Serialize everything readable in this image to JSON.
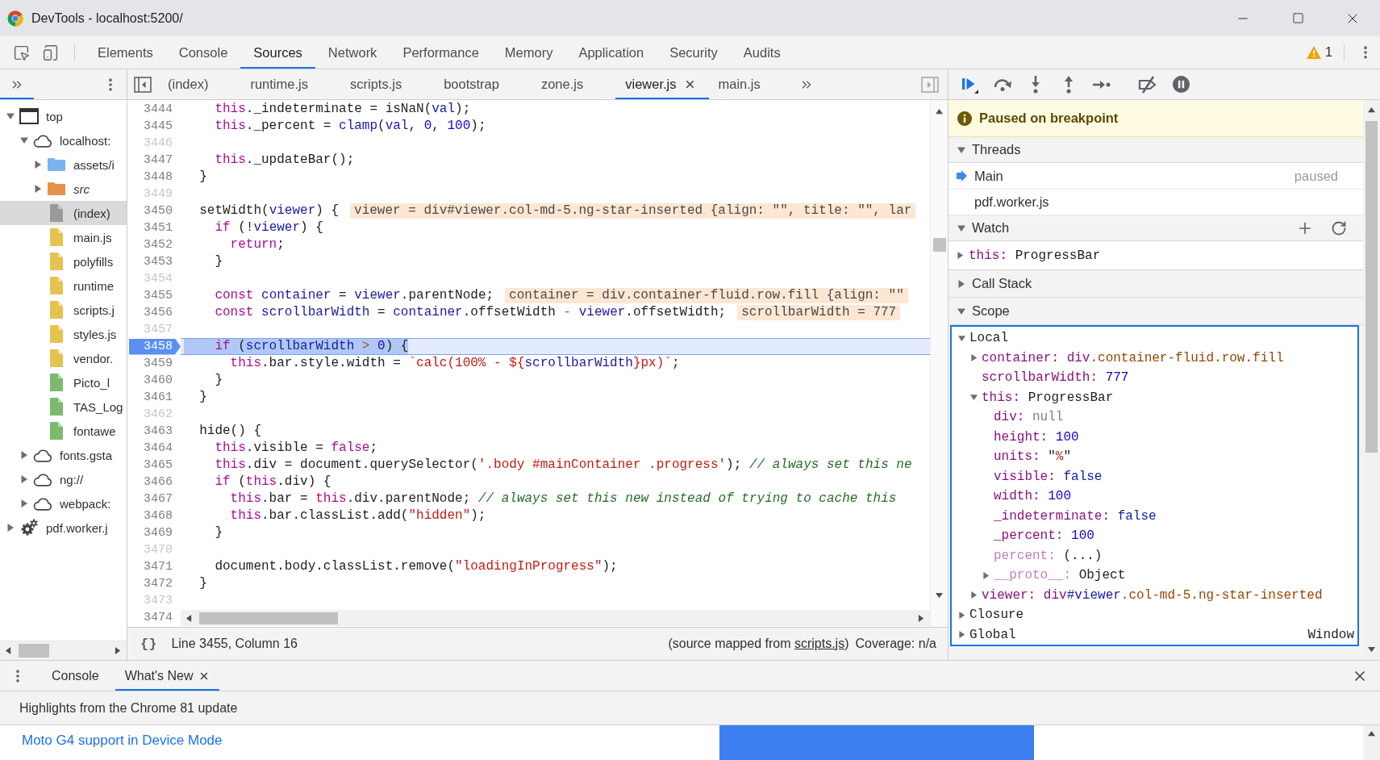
{
  "window": {
    "title": "DevTools - localhost:5200/"
  },
  "main_tabs": [
    {
      "label": "Elements",
      "selected": false
    },
    {
      "label": "Console",
      "selected": false
    },
    {
      "label": "Sources",
      "selected": true
    },
    {
      "label": "Network",
      "selected": false
    },
    {
      "label": "Performance",
      "selected": false
    },
    {
      "label": "Memory",
      "selected": false
    },
    {
      "label": "Application",
      "selected": false
    },
    {
      "label": "Security",
      "selected": false
    },
    {
      "label": "Audits",
      "selected": false
    }
  ],
  "warnings": {
    "count": "1"
  },
  "navigator": {
    "tree": [
      {
        "kind": "frame",
        "label": "top",
        "expanded": true,
        "selected": false,
        "children": [
          {
            "kind": "domain",
            "label": "localhost:",
            "expanded": true,
            "selected": false,
            "children": [
              {
                "kind": "folder",
                "label": "assets/i",
                "expanded": false,
                "selected": false,
                "italic": false,
                "color": "#7ab4ee"
              },
              {
                "kind": "folder",
                "label": "src",
                "expanded": false,
                "selected": false,
                "italic": true,
                "color": "#e8914a"
              },
              {
                "kind": "file",
                "label": "(index)",
                "selected": true,
                "color": "#9a9a9a"
              },
              {
                "kind": "file",
                "label": "main.js",
                "selected": false,
                "color": "#e6c24f"
              },
              {
                "kind": "file",
                "label": "polyfills",
                "selected": false,
                "color": "#e6c24f"
              },
              {
                "kind": "file",
                "label": "runtime",
                "selected": false,
                "color": "#e6c24f"
              },
              {
                "kind": "file",
                "label": "scripts.j",
                "selected": false,
                "color": "#e6c24f"
              },
              {
                "kind": "file",
                "label": "styles.js",
                "selected": false,
                "color": "#e6c24f"
              },
              {
                "kind": "file",
                "label": "vendor.",
                "selected": false,
                "color": "#e6c24f"
              },
              {
                "kind": "file",
                "label": "Picto_l",
                "selected": false,
                "color": "#7cba6e"
              },
              {
                "kind": "file",
                "label": "TAS_Log",
                "selected": false,
                "color": "#7cba6e"
              },
              {
                "kind": "file",
                "label": "fontawe",
                "selected": false,
                "color": "#7cba6e"
              }
            ]
          },
          {
            "kind": "domain",
            "label": "fonts.gsta",
            "expanded": false,
            "selected": false
          },
          {
            "kind": "domain",
            "label": "ng://",
            "expanded": false,
            "selected": false
          },
          {
            "kind": "domain",
            "label": "webpack:",
            "expanded": false,
            "selected": false
          }
        ]
      },
      {
        "kind": "worker",
        "label": "pdf.worker.j",
        "expanded": false,
        "selected": false
      }
    ]
  },
  "editor": {
    "tabs": [
      {
        "label": "(index)",
        "selected": false
      },
      {
        "label": "runtime.js",
        "selected": false
      },
      {
        "label": "scripts.js",
        "selected": false
      },
      {
        "label": "bootstrap",
        "selected": false
      },
      {
        "label": "zone.js",
        "selected": false
      },
      {
        "label": "viewer.js",
        "selected": true
      },
      {
        "label": "main.js",
        "selected": false
      }
    ],
    "code_lines": [
      {
        "number": "3444",
        "muted": false,
        "breakpoint": false,
        "current": false,
        "tokens": [
          {
            "kind": "keyword",
            "text": "    this"
          },
          {
            "kind": "plain",
            "text": "._indeterminate = isNaN("
          },
          {
            "kind": "variable",
            "text": "val"
          },
          {
            "kind": "plain",
            "text": ");"
          }
        ]
      },
      {
        "number": "3445",
        "muted": false,
        "breakpoint": false,
        "current": false,
        "tokens": [
          {
            "kind": "keyword",
            "text": "    this"
          },
          {
            "kind": "plain",
            "text": "._percent = "
          },
          {
            "kind": "variable",
            "text": "clamp"
          },
          {
            "kind": "plain",
            "text": "("
          },
          {
            "kind": "variable",
            "text": "val"
          },
          {
            "kind": "plain",
            "text": ", "
          },
          {
            "kind": "number",
            "text": "0"
          },
          {
            "kind": "plain",
            "text": ", "
          },
          {
            "kind": "number",
            "text": "100"
          },
          {
            "kind": "plain",
            "text": ");"
          }
        ]
      },
      {
        "number": "3446",
        "muted": true,
        "breakpoint": false,
        "current": false
      },
      {
        "number": "3447",
        "muted": false,
        "breakpoint": false,
        "current": false,
        "tokens": [
          {
            "kind": "keyword",
            "text": "    this"
          },
          {
            "kind": "plain",
            "text": "._updateBar();"
          }
        ]
      },
      {
        "number": "3448",
        "muted": false,
        "breakpoint": false,
        "current": false,
        "tokens": [
          {
            "kind": "plain",
            "text": "  }"
          }
        ]
      },
      {
        "number": "3449",
        "muted": true,
        "breakpoint": false,
        "current": false
      },
      {
        "number": "3450",
        "muted": false,
        "breakpoint": false,
        "current": false,
        "tokens": [
          {
            "kind": "plain",
            "text": "  setWidth("
          },
          {
            "kind": "variable",
            "text": "viewer"
          },
          {
            "kind": "plain",
            "text": ") {"
          }
        ],
        "inline_value": "viewer = div#viewer.col-md-5.ng-star-inserted {align: \"\", title: \"\", lar"
      },
      {
        "number": "3451",
        "muted": false,
        "breakpoint": false,
        "current": false,
        "tokens": [
          {
            "kind": "keyword",
            "text": "    if"
          },
          {
            "kind": "plain",
            "text": " (!"
          },
          {
            "kind": "variable",
            "text": "viewer"
          },
          {
            "kind": "plain",
            "text": ") {"
          }
        ]
      },
      {
        "number": "3452",
        "muted": false,
        "breakpoint": false,
        "current": false,
        "tokens": [
          {
            "kind": "keyword",
            "text": "      return"
          },
          {
            "kind": "plain",
            "text": ";"
          }
        ]
      },
      {
        "number": "3453",
        "muted": false,
        "breakpoint": false,
        "current": false,
        "tokens": [
          {
            "kind": "plain",
            "text": "    }"
          }
        ]
      },
      {
        "number": "3454",
        "muted": true,
        "breakpoint": false,
        "current": false
      },
      {
        "number": "3455",
        "muted": false,
        "breakpoint": false,
        "current": false,
        "tokens": [
          {
            "kind": "keyword",
            "text": "    const"
          },
          {
            "kind": "variable",
            "text": " container"
          },
          {
            "kind": "plain",
            "text": " = "
          },
          {
            "kind": "variable",
            "text": "viewer"
          },
          {
            "kind": "plain",
            "text": ".parentNode;"
          }
        ],
        "inline_value": "container = div.container-fluid.row.fill {align: \"\""
      },
      {
        "number": "3456",
        "muted": false,
        "breakpoint": false,
        "current": false,
        "tokens": [
          {
            "kind": "keyword",
            "text": "    const"
          },
          {
            "kind": "variable",
            "text": " scrollbarWidth"
          },
          {
            "kind": "plain",
            "text": " = "
          },
          {
            "kind": "variable",
            "text": "container"
          },
          {
            "kind": "plain",
            "text": ".offsetWidth "
          },
          {
            "kind": "operator",
            "text": "-"
          },
          {
            "kind": "variable",
            "text": " viewer"
          },
          {
            "kind": "plain",
            "text": ".offsetWidth;"
          }
        ],
        "inline_value": "scrollbarWidth = 777"
      },
      {
        "number": "3457",
        "muted": true,
        "breakpoint": false,
        "current": false
      },
      {
        "number": "3458",
        "muted": false,
        "breakpoint": true,
        "current": true,
        "tokens": [
          {
            "kind": "keyword",
            "text": "    if"
          },
          {
            "kind": "plain",
            "text": " ("
          },
          {
            "kind": "variable",
            "text": "scrollbarWidth"
          },
          {
            "kind": "operator",
            "text": " >"
          },
          {
            "kind": "number",
            "text": " 0"
          },
          {
            "kind": "plain",
            "text": ") {"
          }
        ]
      },
      {
        "number": "3459",
        "muted": false,
        "breakpoint": false,
        "current": false,
        "tokens": [
          {
            "kind": "keyword",
            "text": "      this"
          },
          {
            "kind": "plain",
            "text": ".bar.style.width = "
          },
          {
            "kind": "string",
            "text": "`calc(100% - ${"
          },
          {
            "kind": "variable",
            "text": "scrollbarWidth"
          },
          {
            "kind": "string",
            "text": "}px)`"
          },
          {
            "kind": "plain",
            "text": ";"
          }
        ]
      },
      {
        "number": "3460",
        "muted": false,
        "breakpoint": false,
        "current": false,
        "tokens": [
          {
            "kind": "plain",
            "text": "    }"
          }
        ]
      },
      {
        "number": "3461",
        "muted": false,
        "breakpoint": false,
        "current": false,
        "tokens": [
          {
            "kind": "plain",
            "text": "  }"
          }
        ]
      },
      {
        "number": "3462",
        "muted": true,
        "breakpoint": false,
        "current": false
      },
      {
        "number": "3463",
        "muted": false,
        "breakpoint": false,
        "current": false,
        "tokens": [
          {
            "kind": "plain",
            "text": "  hide() {"
          }
        ]
      },
      {
        "number": "3464",
        "muted": false,
        "breakpoint": false,
        "current": false,
        "tokens": [
          {
            "kind": "keyword",
            "text": "    this"
          },
          {
            "kind": "plain",
            "text": ".visible = "
          },
          {
            "kind": "keyword",
            "text": "false"
          },
          {
            "kind": "plain",
            "text": ";"
          }
        ]
      },
      {
        "number": "3465",
        "muted": false,
        "breakpoint": false,
        "current": false,
        "tokens": [
          {
            "kind": "keyword",
            "text": "    this"
          },
          {
            "kind": "plain",
            "text": ".div = document.querySelector("
          },
          {
            "kind": "string",
            "text": "'.body #mainContainer .progress'"
          },
          {
            "kind": "plain",
            "text": "); "
          },
          {
            "kind": "comment",
            "text": "// always set this ne"
          }
        ]
      },
      {
        "number": "3466",
        "muted": false,
        "breakpoint": false,
        "current": false,
        "tokens": [
          {
            "kind": "keyword",
            "text": "    if"
          },
          {
            "kind": "plain",
            "text": " ("
          },
          {
            "kind": "keyword",
            "text": "this"
          },
          {
            "kind": "plain",
            "text": ".div) {"
          }
        ]
      },
      {
        "number": "3467",
        "muted": false,
        "breakpoint": false,
        "current": false,
        "tokens": [
          {
            "kind": "keyword",
            "text": "      this"
          },
          {
            "kind": "plain",
            "text": ".bar = "
          },
          {
            "kind": "keyword",
            "text": "this"
          },
          {
            "kind": "plain",
            "text": ".div.parentNode; "
          },
          {
            "kind": "comment",
            "text": "// always set this new instead of trying to cache this"
          }
        ]
      },
      {
        "number": "3468",
        "muted": false,
        "breakpoint": false,
        "current": false,
        "tokens": [
          {
            "kind": "keyword",
            "text": "      this"
          },
          {
            "kind": "plain",
            "text": ".bar.classList.add("
          },
          {
            "kind": "string",
            "text": "\"hidden\""
          },
          {
            "kind": "plain",
            "text": ");"
          }
        ]
      },
      {
        "number": "3469",
        "muted": false,
        "breakpoint": false,
        "current": false,
        "tokens": [
          {
            "kind": "plain",
            "text": "    }"
          }
        ]
      },
      {
        "number": "3470",
        "muted": true,
        "breakpoint": false,
        "current": false
      },
      {
        "number": "3471",
        "muted": false,
        "breakpoint": false,
        "current": false,
        "tokens": [
          {
            "kind": "plain",
            "text": "    document.body.classList.remove("
          },
          {
            "kind": "string",
            "text": "\"loadingInProgress\""
          },
          {
            "kind": "plain",
            "text": ");"
          }
        ]
      },
      {
        "number": "3472",
        "muted": false,
        "breakpoint": false,
        "current": false,
        "tokens": [
          {
            "kind": "plain",
            "text": "  }"
          }
        ]
      },
      {
        "number": "3473",
        "muted": true,
        "breakpoint": false,
        "current": false
      },
      {
        "number": "3474",
        "muted": false,
        "breakpoint": false,
        "current": false
      }
    ],
    "status": {
      "format_button": "{}",
      "position": "Line 3455, Column 16",
      "source_before": "(source mapped from",
      "source_link": "scripts.js",
      "source_after": ")",
      "coverage": "Coverage: n/a"
    }
  },
  "debugger": {
    "paused_message": "Paused on breakpoint",
    "threads": {
      "title": "Threads",
      "expanded": true,
      "items": [
        {
          "name": "Main",
          "status": "paused",
          "selected": true
        },
        {
          "name": "pdf.worker.js",
          "selected": false
        }
      ]
    },
    "watch": {
      "title": "Watch",
      "expanded": true,
      "items": [
        {
          "name": "this:",
          "value": "ProgressBar",
          "expanded": false
        }
      ]
    },
    "call_stack": {
      "title": "Call Stack",
      "expanded": false
    },
    "scope": {
      "title": "Scope",
      "expanded": true,
      "groups": [
        {
          "name": "Local",
          "expanded": true,
          "entries": [
            {
              "kind": "object",
              "name": "container:",
              "dimmed": false,
              "expanded": false,
              "value": [
                {
                  "kind": "tag",
                  "text": "div"
                },
                {
                  "kind": "class",
                  "text": ".container-fluid.row.fill"
                }
              ]
            },
            {
              "kind": "value",
              "name": "scrollbarWidth:",
              "dimmed": false,
              "value": [
                {
                  "kind": "number",
                  "text": "777"
                }
              ]
            },
            {
              "kind": "object",
              "name": "this:",
              "dimmed": false,
              "expanded": true,
              "value": [
                {
                  "kind": "plain",
                  "text": "ProgressBar"
                }
              ],
              "children": [
                {
                  "kind": "value",
                  "name": "div:",
                  "dimmed": false,
                  "value": [
                    {
                      "kind": "null",
                      "text": "null"
                    }
                  ]
                },
                {
                  "kind": "value",
                  "name": "height:",
                  "dimmed": false,
                  "value": [
                    {
                      "kind": "number",
                      "text": "100"
                    }
                  ]
                },
                {
                  "kind": "value",
                  "name": "units:",
                  "dimmed": false,
                  "value": [
                    {
                      "kind": "plain",
                      "text": "\""
                    },
                    {
                      "kind": "string",
                      "text": "%"
                    },
                    {
                      "kind": "plain",
                      "text": "\""
                    }
                  ]
                },
                {
                  "kind": "value",
                  "name": "visible:",
                  "dimmed": false,
                  "value": [
                    {
                      "kind": "boolean",
                      "text": "false"
                    }
                  ]
                },
                {
                  "kind": "value",
                  "name": "width:",
                  "dimmed": false,
                  "value": [
                    {
                      "kind": "number",
                      "text": "100"
                    }
                  ]
                },
                {
                  "kind": "value",
                  "name": "_indeterminate:",
                  "dimmed": false,
                  "value": [
                    {
                      "kind": "boolean",
                      "text": "false"
                    }
                  ]
                },
                {
                  "kind": "value",
                  "name": "_percent:",
                  "dimmed": false,
                  "value": [
                    {
                      "kind": "number",
                      "text": "100"
                    }
                  ]
                },
                {
                  "kind": "value",
                  "name": "percent:",
                  "dimmed": true,
                  "value": [
                    {
                      "kind": "plain",
                      "text": "(...)"
                    }
                  ]
                },
                {
                  "kind": "object",
                  "name": "__proto__:",
                  "dimmed": true,
                  "expanded": false,
                  "value": [
                    {
                      "kind": "plain",
                      "text": "Object"
                    }
                  ]
                }
              ]
            },
            {
              "kind": "object",
              "name": "viewer:",
              "dimmed": false,
              "expanded": false,
              "value": [
                {
                  "kind": "tag",
                  "text": "div"
                },
                {
                  "kind": "id",
                  "text": "#viewer"
                },
                {
                  "kind": "class",
                  "text": ".col-md-5.ng-star-inserted"
                }
              ]
            }
          ]
        },
        {
          "name": "Closure",
          "expanded": false
        },
        {
          "name": "Global",
          "expanded": false,
          "value": "Window"
        }
      ]
    }
  },
  "drawer": {
    "tabs": [
      {
        "label": "Console",
        "selected": false,
        "closable": false
      },
      {
        "label": "What's New",
        "selected": true,
        "closable": true
      }
    ],
    "heading": "Highlights from the Chrome 81 update",
    "link": "Moto G4 support in Device Mode"
  }
}
